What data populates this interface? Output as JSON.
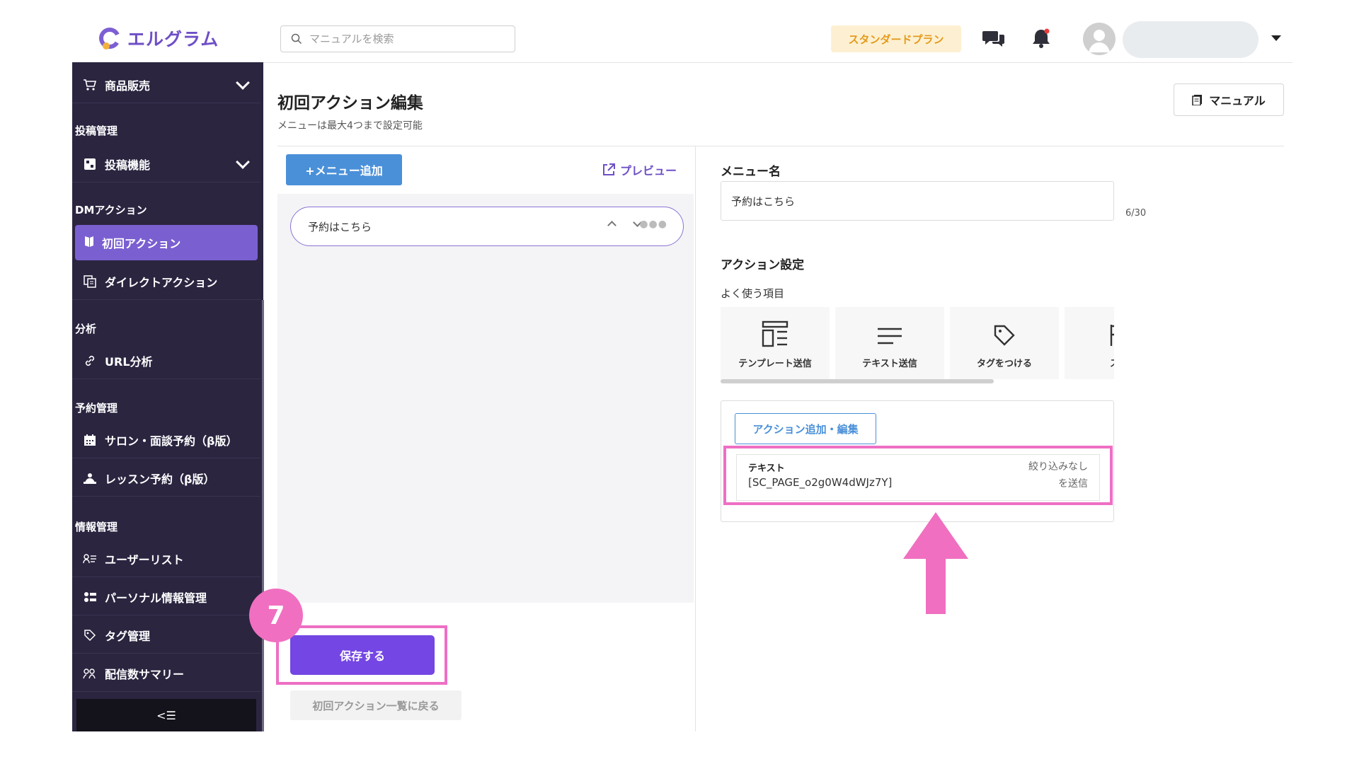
{
  "header": {
    "logo_text": "エルグラム",
    "search_placeholder": "マニュアルを検索",
    "plan_badge": "スタンダードプラン",
    "icons": [
      "chat-icon",
      "bell-icon",
      "avatar",
      "caret-down-icon"
    ],
    "colors": {
      "brand": "#6e4fc6",
      "plan_bg": "#fdf0d2",
      "plan_text": "#e49a1c"
    }
  },
  "sidebar": {
    "items": {
      "shop": "商品販売",
      "sec_post": "投稿管理",
      "post_feature": "投稿機能",
      "sec_dm": "DMアクション",
      "first_action": "初回アクション",
      "direct_action": "ダイレクトアクション",
      "sec_analysis": "分析",
      "url_analysis": "URL分析",
      "sec_booking": "予約管理",
      "salon_booking": "サロン・面談予約（β版）",
      "lesson_booking": "レッスン予約（β版）",
      "sec_info": "情報管理",
      "user_list": "ユーザーリスト",
      "personal_info": "パーソナル情報管理",
      "tag_manage": "タグ管理",
      "delivery_summary": "配信数サマリー"
    },
    "collapse_icon": "<☰",
    "colors": {
      "bg": "#2b2540",
      "active": "#7a5fd1"
    }
  },
  "main": {
    "title": "初回アクション編集",
    "subtitle": "メニューは最大4つまで設定可能",
    "manual_button": "マニュアル",
    "add_menu_button": "+メニュー追加",
    "preview_link": "プレビュー",
    "menu_items": [
      {
        "label": "予約はこちら"
      }
    ],
    "step_number": "7",
    "save_button": "保存する",
    "back_button": "初回アクション一覧に戻る"
  },
  "editor": {
    "menu_name_label": "メニュー名",
    "menu_name_value": "予約はこちら",
    "char_count": "6/30",
    "action_settings_label": "アクション設定",
    "common_items_label": "よく使う項目",
    "quick_actions": [
      {
        "label": "テンプレート送信",
        "icon": "template-icon"
      },
      {
        "label": "テキスト送信",
        "icon": "text-lines-icon"
      },
      {
        "label": "タグをつける",
        "icon": "tag-icon"
      },
      {
        "label": "ステ",
        "icon": "flag-icon"
      }
    ],
    "action_edit_button": "アクション追加・編集",
    "action_row": {
      "type": "テキスト",
      "value": "[SC_PAGE_o2g0W4dWJz7Y]",
      "filter": "絞り込みなし",
      "send": "を送信"
    },
    "colors": {
      "highlight": "#ee6fc4",
      "accent_blue": "#4a90d9",
      "save_purple": "#7446e3"
    }
  }
}
